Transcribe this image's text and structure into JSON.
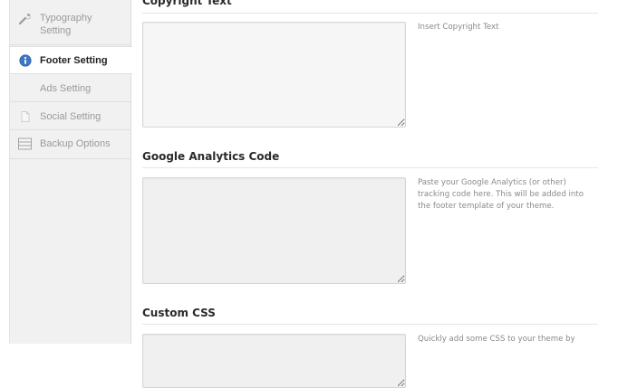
{
  "sidebar": {
    "items": [
      {
        "label": "Typography\nSetting",
        "icon": "wrench-icon"
      },
      {
        "label": "Footer Setting",
        "icon": "info-icon"
      },
      {
        "label": "Ads Setting",
        "icon": ""
      },
      {
        "label": "Social Setting",
        "icon": "document-icon"
      },
      {
        "label": "Backup Options",
        "icon": "list-icon"
      }
    ]
  },
  "main": {
    "sections": [
      {
        "title": "Copyright Text",
        "description": "Insert Copyright Text",
        "value": ""
      },
      {
        "title": "Google Analytics Code",
        "description": "Paste your Google Analytics (or other) tracking code here. This will be added into the footer template of your theme.",
        "value": ""
      },
      {
        "title": "Custom CSS",
        "description": "Quickly add some CSS to your theme by",
        "value": ""
      }
    ]
  },
  "colors": {
    "sidebar_bg": "#f1f1f1",
    "active_bg": "#ffffff",
    "info_icon": "#3a78c3"
  }
}
